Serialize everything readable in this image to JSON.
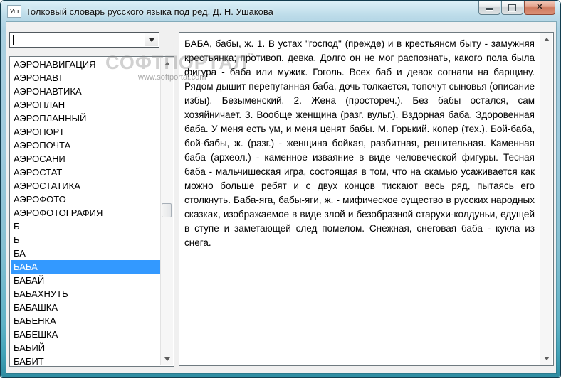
{
  "window": {
    "title": "Толковый словарь русского языка под ред. Д. Н. Ушакова",
    "icon_text": "Уш",
    "controls": {
      "close_glyph": "✕"
    }
  },
  "search": {
    "value": "",
    "placeholder": ""
  },
  "word_list": {
    "items": [
      "АЭРОНАВИГАЦИЯ",
      "АЭРОНАВТ",
      "АЭРОНАВТИКА",
      "АЭРОПЛАН",
      "АЭРОПЛАННЫЙ",
      "АЭРОПОРТ",
      "АЭРОПОЧТА",
      "АЭРОСАНИ",
      "АЭРОСТАТ",
      "АЭРОСТАТИКА",
      "АЭРОФОТО",
      "АЭРОФОТОГРАФИЯ",
      "Б",
      "Б",
      "БА",
      "БАБА",
      "БАБАЙ",
      "БАБАХНУТЬ",
      "БАБАШКА",
      "БАБЕНКА",
      "БАБЕШКА",
      "БАБИЙ",
      "БАБИТ"
    ],
    "selected_index": 15,
    "selected_item": "БАБА"
  },
  "definition": {
    "text": "БАБА, бабы, ж. 1. В устах \"господ\" (прежде) и в крестьянсм быту - замужняя крестьянка; противоп. девка. Долго он не мог распознать, какого пола была фигура - баба или мужик. Гоголь. Всех баб и девок согнали на барщину. Рядом дышит перепуганная баба, дочь толкается, топочут сыновья (описание избы). Безыменский. 2. Жена (простореч.). Без бабы остался, сам хозяйничает. 3. Вообще женщина (разг. вульг.). Вздорная баба. Здоровенная баба. У меня есть ум, и меня ценят бабы. М. Горький. копер (тех.). Бой-баба, бой-бабы, ж. (разг.) - женщина бойкая, разбитная, решительная. Каменная баба (археол.) - каменное изваяние в виде человеческой фигуры. Тесная баба - мальчишеская игра, состоящая в том, что на скамью усаживается как можно больше ребят и с двух концов тискают весь ряд, пытаясь его столкнуть. Баба-яга, бабы-яги, ж. - мифическое существо в русских народных сказках, изображаемое в виде злой и безобразной старухи-колдуньи, едущей в ступе и заметающей след помелом. Снежная, снеговая баба - кукла из снега."
  },
  "watermark": {
    "brand": "СОФТПОРТАЛ",
    "tm": "™",
    "url": "www.softportal.com"
  },
  "colors": {
    "selection": "#3399FF",
    "frame_teal": "#3E9FB4",
    "titlebar": "#B9D9E9",
    "close_button": "#D9846C",
    "client_bg": "#F0F0F0"
  }
}
